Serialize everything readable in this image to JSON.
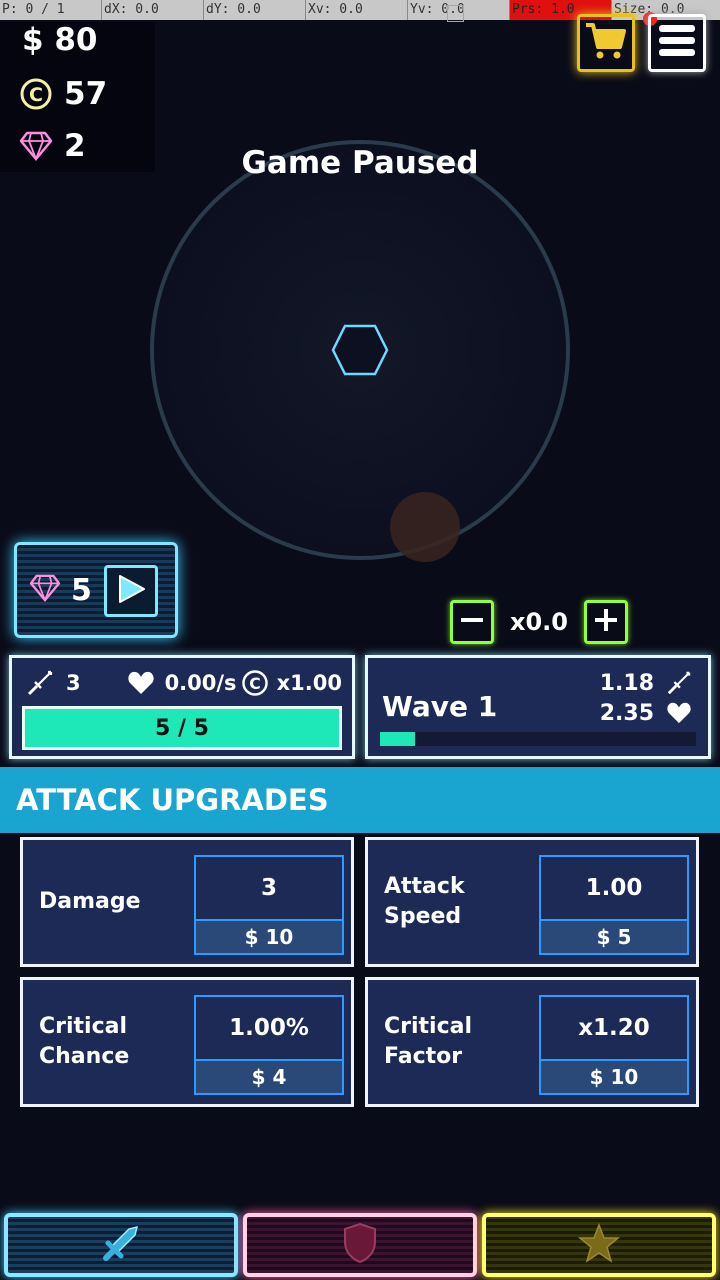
{
  "debug_bar": {
    "pointer": "P: 0 / 1",
    "dx": "dX: 0.0",
    "dy": "dY: 0.0",
    "xv": "Xv: 0.0",
    "yv": "Yv: 0.0",
    "prs": "Prs: 1.0",
    "size": "Size: 0.0"
  },
  "resources": {
    "cash": "$ 80",
    "coins": "57",
    "gems": "2",
    "coin_icon": "coin-icon",
    "gem_icon": "diamond-icon"
  },
  "top_buttons": {
    "shop_icon": "cart-icon",
    "menu_icon": "hamburger-icon"
  },
  "status": {
    "paused_text": "Game Paused"
  },
  "gem_offer": {
    "value": "5",
    "icon": "diamond-icon",
    "button_icon": "play-icon"
  },
  "speed_control": {
    "value": "x0.0"
  },
  "tower_panel": {
    "damage": "3",
    "regen": "0.00/s",
    "coin_multiplier": "x1.00",
    "health": "5 / 5",
    "health_fraction": 1.0
  },
  "wave_panel": {
    "title": "Wave 1",
    "enemy_damage": "1.18",
    "enemy_health": "2.35",
    "progress_fraction": 0.11
  },
  "section": {
    "title": "ATTACK UPGRADES"
  },
  "upgrades": [
    {
      "name": "Damage",
      "value": "3",
      "cost": "$ 10"
    },
    {
      "name": "Attack\nSpeed",
      "value": "1.00",
      "cost": "$ 5"
    },
    {
      "name": "Critical\nChance",
      "value": "1.00%",
      "cost": "$ 4"
    },
    {
      "name": "Critical\nFactor",
      "value": "x1.20",
      "cost": "$ 10"
    }
  ],
  "tabs": [
    {
      "name": "attack",
      "icon": "sword-icon"
    },
    {
      "name": "defense",
      "icon": "shield-icon"
    },
    {
      "name": "utility",
      "icon": "star-icon"
    }
  ],
  "colors": {
    "background": "#0a0b18",
    "panel": "#1e2a56",
    "accent_teal": "#1ee8b8",
    "section_header": "#1aa4d0",
    "shop_gold": "#e8c020",
    "speed_green": "#90ff40",
    "debug_red": "#e01010"
  }
}
